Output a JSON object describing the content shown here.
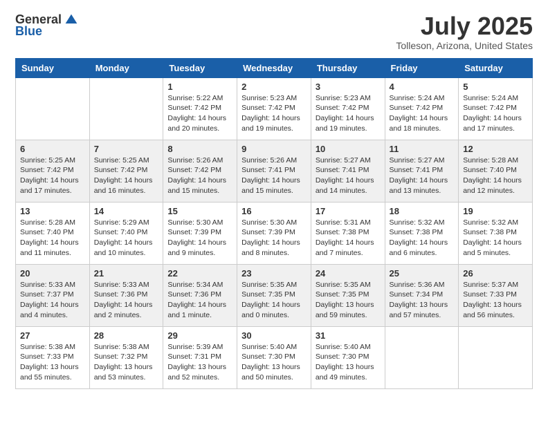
{
  "logo": {
    "general": "General",
    "blue": "Blue"
  },
  "header": {
    "month": "July 2025",
    "location": "Tolleson, Arizona, United States"
  },
  "weekdays": [
    "Sunday",
    "Monday",
    "Tuesday",
    "Wednesday",
    "Thursday",
    "Friday",
    "Saturday"
  ],
  "weeks": [
    [
      {
        "day": "",
        "sunrise": "",
        "sunset": "",
        "daylight": ""
      },
      {
        "day": "",
        "sunrise": "",
        "sunset": "",
        "daylight": ""
      },
      {
        "day": "1",
        "sunrise": "Sunrise: 5:22 AM",
        "sunset": "Sunset: 7:42 PM",
        "daylight": "Daylight: 14 hours and 20 minutes."
      },
      {
        "day": "2",
        "sunrise": "Sunrise: 5:23 AM",
        "sunset": "Sunset: 7:42 PM",
        "daylight": "Daylight: 14 hours and 19 minutes."
      },
      {
        "day": "3",
        "sunrise": "Sunrise: 5:23 AM",
        "sunset": "Sunset: 7:42 PM",
        "daylight": "Daylight: 14 hours and 19 minutes."
      },
      {
        "day": "4",
        "sunrise": "Sunrise: 5:24 AM",
        "sunset": "Sunset: 7:42 PM",
        "daylight": "Daylight: 14 hours and 18 minutes."
      },
      {
        "day": "5",
        "sunrise": "Sunrise: 5:24 AM",
        "sunset": "Sunset: 7:42 PM",
        "daylight": "Daylight: 14 hours and 17 minutes."
      }
    ],
    [
      {
        "day": "6",
        "sunrise": "Sunrise: 5:25 AM",
        "sunset": "Sunset: 7:42 PM",
        "daylight": "Daylight: 14 hours and 17 minutes."
      },
      {
        "day": "7",
        "sunrise": "Sunrise: 5:25 AM",
        "sunset": "Sunset: 7:42 PM",
        "daylight": "Daylight: 14 hours and 16 minutes."
      },
      {
        "day": "8",
        "sunrise": "Sunrise: 5:26 AM",
        "sunset": "Sunset: 7:42 PM",
        "daylight": "Daylight: 14 hours and 15 minutes."
      },
      {
        "day": "9",
        "sunrise": "Sunrise: 5:26 AM",
        "sunset": "Sunset: 7:41 PM",
        "daylight": "Daylight: 14 hours and 15 minutes."
      },
      {
        "day": "10",
        "sunrise": "Sunrise: 5:27 AM",
        "sunset": "Sunset: 7:41 PM",
        "daylight": "Daylight: 14 hours and 14 minutes."
      },
      {
        "day": "11",
        "sunrise": "Sunrise: 5:27 AM",
        "sunset": "Sunset: 7:41 PM",
        "daylight": "Daylight: 14 hours and 13 minutes."
      },
      {
        "day": "12",
        "sunrise": "Sunrise: 5:28 AM",
        "sunset": "Sunset: 7:40 PM",
        "daylight": "Daylight: 14 hours and 12 minutes."
      }
    ],
    [
      {
        "day": "13",
        "sunrise": "Sunrise: 5:28 AM",
        "sunset": "Sunset: 7:40 PM",
        "daylight": "Daylight: 14 hours and 11 minutes."
      },
      {
        "day": "14",
        "sunrise": "Sunrise: 5:29 AM",
        "sunset": "Sunset: 7:40 PM",
        "daylight": "Daylight: 14 hours and 10 minutes."
      },
      {
        "day": "15",
        "sunrise": "Sunrise: 5:30 AM",
        "sunset": "Sunset: 7:39 PM",
        "daylight": "Daylight: 14 hours and 9 minutes."
      },
      {
        "day": "16",
        "sunrise": "Sunrise: 5:30 AM",
        "sunset": "Sunset: 7:39 PM",
        "daylight": "Daylight: 14 hours and 8 minutes."
      },
      {
        "day": "17",
        "sunrise": "Sunrise: 5:31 AM",
        "sunset": "Sunset: 7:38 PM",
        "daylight": "Daylight: 14 hours and 7 minutes."
      },
      {
        "day": "18",
        "sunrise": "Sunrise: 5:32 AM",
        "sunset": "Sunset: 7:38 PM",
        "daylight": "Daylight: 14 hours and 6 minutes."
      },
      {
        "day": "19",
        "sunrise": "Sunrise: 5:32 AM",
        "sunset": "Sunset: 7:38 PM",
        "daylight": "Daylight: 14 hours and 5 minutes."
      }
    ],
    [
      {
        "day": "20",
        "sunrise": "Sunrise: 5:33 AM",
        "sunset": "Sunset: 7:37 PM",
        "daylight": "Daylight: 14 hours and 4 minutes."
      },
      {
        "day": "21",
        "sunrise": "Sunrise: 5:33 AM",
        "sunset": "Sunset: 7:36 PM",
        "daylight": "Daylight: 14 hours and 2 minutes."
      },
      {
        "day": "22",
        "sunrise": "Sunrise: 5:34 AM",
        "sunset": "Sunset: 7:36 PM",
        "daylight": "Daylight: 14 hours and 1 minute."
      },
      {
        "day": "23",
        "sunrise": "Sunrise: 5:35 AM",
        "sunset": "Sunset: 7:35 PM",
        "daylight": "Daylight: 14 hours and 0 minutes."
      },
      {
        "day": "24",
        "sunrise": "Sunrise: 5:35 AM",
        "sunset": "Sunset: 7:35 PM",
        "daylight": "Daylight: 13 hours and 59 minutes."
      },
      {
        "day": "25",
        "sunrise": "Sunrise: 5:36 AM",
        "sunset": "Sunset: 7:34 PM",
        "daylight": "Daylight: 13 hours and 57 minutes."
      },
      {
        "day": "26",
        "sunrise": "Sunrise: 5:37 AM",
        "sunset": "Sunset: 7:33 PM",
        "daylight": "Daylight: 13 hours and 56 minutes."
      }
    ],
    [
      {
        "day": "27",
        "sunrise": "Sunrise: 5:38 AM",
        "sunset": "Sunset: 7:33 PM",
        "daylight": "Daylight: 13 hours and 55 minutes."
      },
      {
        "day": "28",
        "sunrise": "Sunrise: 5:38 AM",
        "sunset": "Sunset: 7:32 PM",
        "daylight": "Daylight: 13 hours and 53 minutes."
      },
      {
        "day": "29",
        "sunrise": "Sunrise: 5:39 AM",
        "sunset": "Sunset: 7:31 PM",
        "daylight": "Daylight: 13 hours and 52 minutes."
      },
      {
        "day": "30",
        "sunrise": "Sunrise: 5:40 AM",
        "sunset": "Sunset: 7:30 PM",
        "daylight": "Daylight: 13 hours and 50 minutes."
      },
      {
        "day": "31",
        "sunrise": "Sunrise: 5:40 AM",
        "sunset": "Sunset: 7:30 PM",
        "daylight": "Daylight: 13 hours and 49 minutes."
      },
      {
        "day": "",
        "sunrise": "",
        "sunset": "",
        "daylight": ""
      },
      {
        "day": "",
        "sunrise": "",
        "sunset": "",
        "daylight": ""
      }
    ]
  ]
}
